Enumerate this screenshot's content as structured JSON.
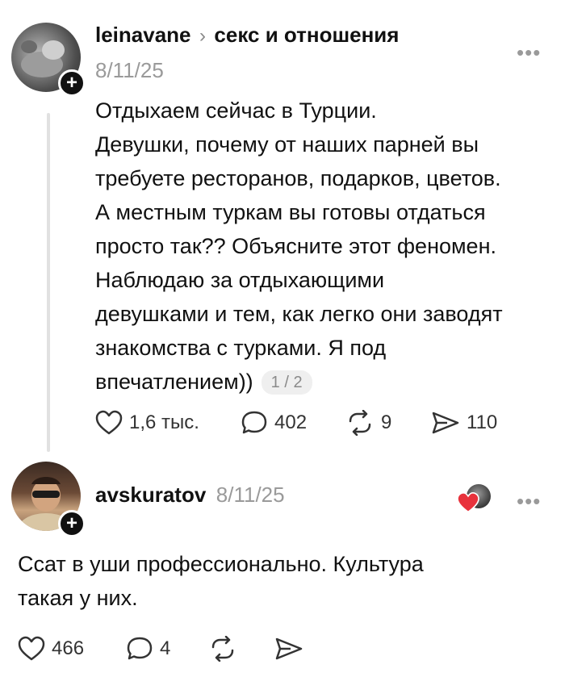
{
  "post": {
    "username": "leinavane",
    "community": "секс и отношения",
    "date": "8/11/25",
    "lines": [
      "Отдыхаем сейчас в Турции.",
      "Девушки, почему от наших парней вы",
      "требуете ресторанов, подарков, цветов.",
      "А местным туркам вы готовы отдаться",
      "просто так?? Объясните этот феномен.",
      "Наблюдаю за отдыхающими",
      "девушками и тем, как легко они заводят",
      "знакомства с турками. Я под",
      "впечатлением))"
    ],
    "page_indicator": "1 / 2",
    "likes": "1,6 тыс.",
    "comments": "402",
    "reposts": "9",
    "shares": "110"
  },
  "reply": {
    "username": "avskuratov",
    "date": "8/11/25",
    "lines": [
      "Ссат в уши профессионально. Культура",
      "такая у них."
    ],
    "likes": "466",
    "comments": "4"
  },
  "icons": {
    "more": "more-dots-icon",
    "follow": "plus-icon",
    "like": "heart-icon",
    "comment": "comment-bubble-icon",
    "repost": "repost-icon",
    "share": "send-icon",
    "liked_by_author": "heart-badge-icon"
  },
  "colors": {
    "heart_badge": "#e8323c",
    "muted": "#9a9a9a"
  }
}
